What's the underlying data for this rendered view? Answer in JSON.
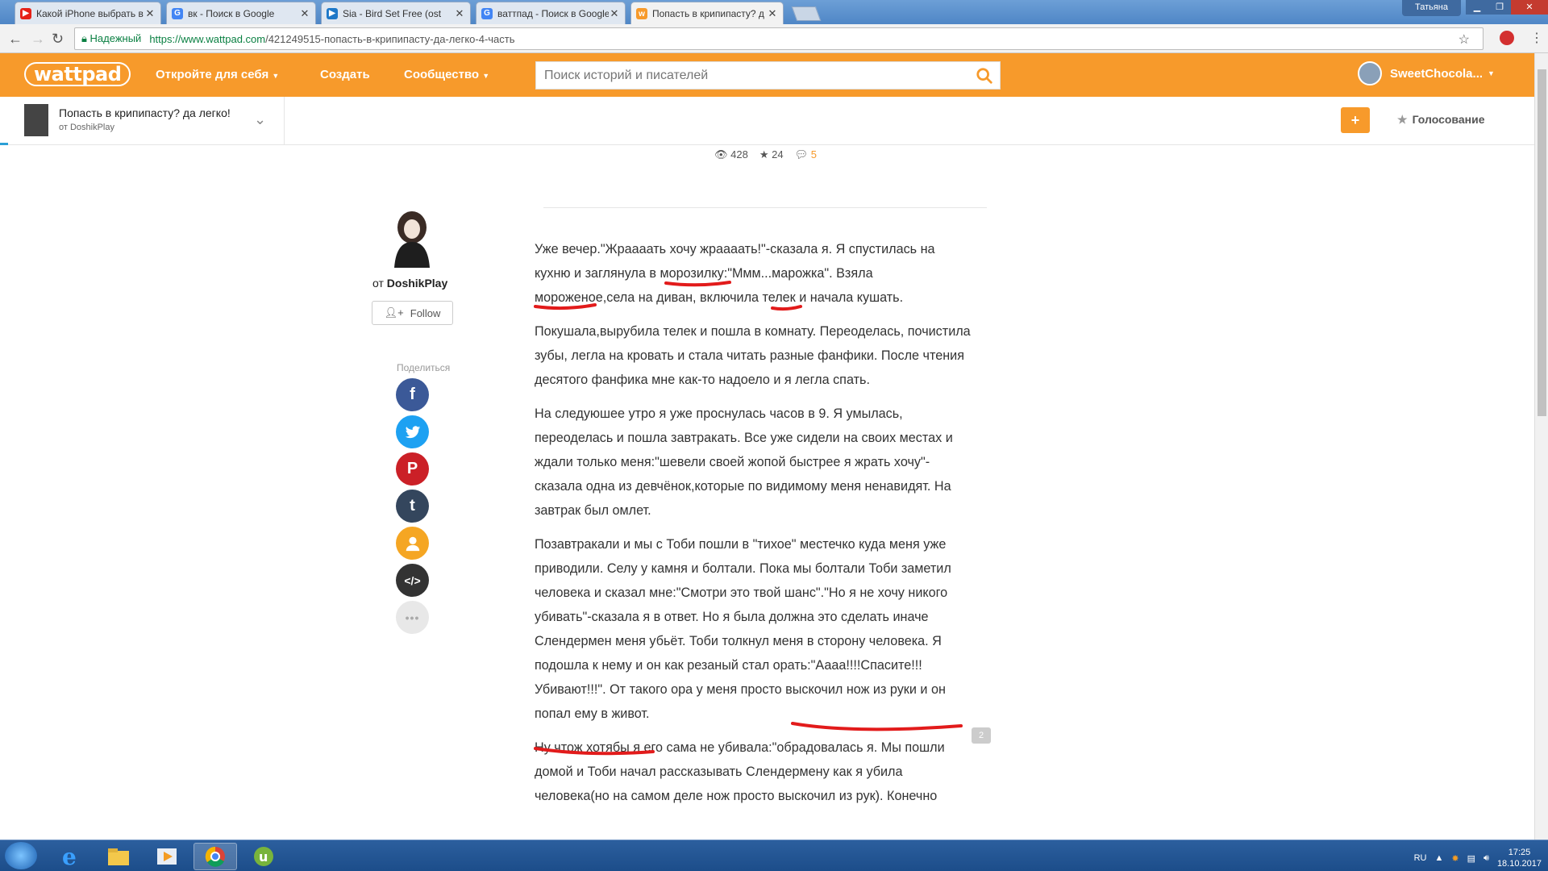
{
  "browser": {
    "tabs": [
      {
        "title": "Какой iPhone выбрать в",
        "favicon": "youtube-icon",
        "color": "#e62117"
      },
      {
        "title": "вк - Поиск в Google",
        "favicon": "google-icon",
        "color": "#4285f4"
      },
      {
        "title": "Sia - Bird Set Free (ost",
        "favicon": "video-icon",
        "color": "#1e78c8"
      },
      {
        "title": "ваттпад - Поиск в Google",
        "favicon": "google-icon",
        "color": "#4285f4"
      },
      {
        "title": "Попасть в крипипасту? д",
        "favicon": "wattpad-icon",
        "color": "#f79a2b",
        "active": true
      }
    ],
    "window_user": "Татьяна",
    "security_label": "Надежный",
    "url_main": "https://www.wattpad.com",
    "url_rest": "/421249515-попасть-в-крипипасту-да-легко-4-часть"
  },
  "header": {
    "logo": "wattpad",
    "nav": [
      "Откройте для себя",
      "Создать",
      "Сообщество"
    ],
    "search_placeholder": "Поиск историй и писателей",
    "username": "SweetChocola...",
    "brand_color": "#f79a2b"
  },
  "storybar": {
    "title": "Попасть в крипипасту? да легко!",
    "author": "от DoshikPlay",
    "plus_label": "+",
    "vote_label": "Голосование"
  },
  "stats": {
    "views": "428",
    "votes": "24",
    "comments": "5"
  },
  "author": {
    "by": "от",
    "name": "DoshikPlay",
    "follow_label": "Follow",
    "share_label": "Поделиться"
  },
  "story": {
    "paragraphs": [
      "Уже вечер.\"Жраааать  хочу жраааать!\"-сказала я. Я спустилась на кухню и заглянула в морозилку:\"Ммм...марожка\". Взяла мороженое,села на диван, включила телек и начала кушать.",
      "Покушала,вырубила телек и пошла в комнату. Переоделась, почистила зубы, легла на кровать и стала читать разные фанфики. После чтения десятого фанфика мне как-то надоело и я легла спать.",
      "На следуюшее утро я уже проснулась часов в 9. Я умылась, переоделась и пошла завтракать. Все уже сидели на своих местах и ждали только меня:\"шевели своей жопой быстрее я жрать хочу\"-сказала одна из девчёнок,которые по видимому меня ненавидят. На завтрак был омлет.",
      "Позавтракали и мы с Тоби пошли в \"тихое\" местечко куда меня уже приводили. Селу у камня и болтали. Пока мы болтали Тоби заметил человека и сказал мне:\"Смотри это твой шанс\".\"Но я не хочу никого убивать\"-сказала я в ответ. Но я была должна это сделать иначе Слендермен меня убьёт. Тоби толкнул меня в сторону человека. Я подошла к нему и он как резаный стал орать:\"Аааа!!!!Спасите!!! Убивают!!!\". От такого ора у меня просто выскочил нож из руки и он попал ему в живот.",
      "Ну чтож хотябы я его сама не убивала:\"обрадовалась я. Мы пошли домой и Тоби начал рассказывать Слендермену как я убила человека(но на самом деле нож просто выскочил из рук). Конечно"
    ],
    "comment_count": "2"
  },
  "share_icons": [
    {
      "name": "facebook",
      "color": "#3b5998",
      "glyph": "f"
    },
    {
      "name": "twitter",
      "color": "#1da1f2",
      "glyph": "t"
    },
    {
      "name": "pinterest",
      "color": "#cb2027",
      "glyph": "P"
    },
    {
      "name": "tumblr",
      "color": "#34465d",
      "glyph": "t"
    },
    {
      "name": "profile",
      "color": "#f5a623",
      "glyph": "●"
    },
    {
      "name": "embed",
      "color": "#333333",
      "glyph": "</>"
    },
    {
      "name": "more",
      "color": "#e8e8e8",
      "glyph": "•••"
    }
  ],
  "taskbar": {
    "lang": "RU",
    "time": "17:25",
    "date": "18.10.2017"
  }
}
